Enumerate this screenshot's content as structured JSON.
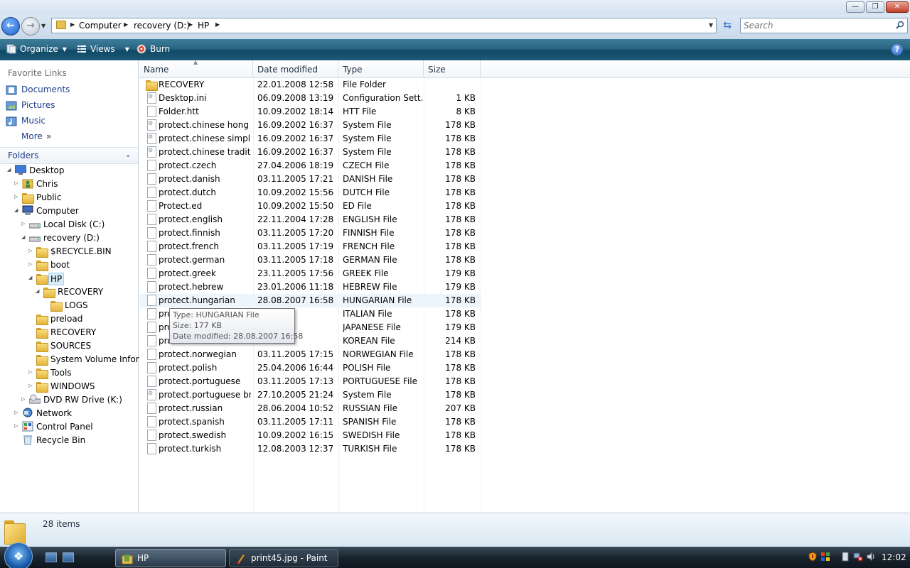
{
  "window": {
    "controls": {
      "minimize": "—",
      "maximize": "❐",
      "close": "✕"
    }
  },
  "address": {
    "crumbs": [
      "Computer",
      "recovery (D:)",
      "HP"
    ]
  },
  "search": {
    "placeholder": "Search"
  },
  "toolbar": {
    "organize": "Organize",
    "views": "Views",
    "burn": "Burn",
    "help": "?"
  },
  "nav": {
    "favorites_title": "Favorite Links",
    "favorites": [
      "Documents",
      "Pictures",
      "Music",
      "More"
    ],
    "folders_label": "Folders",
    "tree": [
      {
        "label": "Desktop",
        "level": 0,
        "exp": "◢",
        "icon": "desktop-icon"
      },
      {
        "label": "Chris",
        "level": 1,
        "exp": "▷",
        "icon": "user-folder-icon"
      },
      {
        "label": "Public",
        "level": 1,
        "exp": "▷",
        "icon": "folder-icon"
      },
      {
        "label": "Computer",
        "level": 1,
        "exp": "◢",
        "icon": "computer-icon"
      },
      {
        "label": "Local Disk (C:)",
        "level": 2,
        "exp": "▷",
        "icon": "drive-icon"
      },
      {
        "label": "recovery (D:)",
        "level": 2,
        "exp": "◢",
        "icon": "drive-icon"
      },
      {
        "label": "$RECYCLE.BIN",
        "level": 3,
        "exp": "▷",
        "icon": "folder-icon"
      },
      {
        "label": "boot",
        "level": 3,
        "exp": "▷",
        "icon": "folder-icon"
      },
      {
        "label": "HP",
        "level": 3,
        "exp": "◢",
        "icon": "folder-icon",
        "selected": true
      },
      {
        "label": "RECOVERY",
        "level": 4,
        "exp": "◢",
        "icon": "folder-icon"
      },
      {
        "label": "LOGS",
        "level": 5,
        "exp": "",
        "icon": "folder-icon"
      },
      {
        "label": "preload",
        "level": 3,
        "exp": "",
        "icon": "folder-icon"
      },
      {
        "label": "RECOVERY",
        "level": 3,
        "exp": "",
        "icon": "folder-icon"
      },
      {
        "label": "SOURCES",
        "level": 3,
        "exp": "",
        "icon": "folder-icon"
      },
      {
        "label": "System Volume Inform",
        "level": 3,
        "exp": "",
        "icon": "folder-icon"
      },
      {
        "label": "Tools",
        "level": 3,
        "exp": "▷",
        "icon": "folder-icon"
      },
      {
        "label": "WINDOWS",
        "level": 3,
        "exp": "▷",
        "icon": "folder-icon"
      },
      {
        "label": "DVD RW Drive (K:)",
        "level": 2,
        "exp": "▷",
        "icon": "dvd-drive-icon"
      },
      {
        "label": "Network",
        "level": 1,
        "exp": "▷",
        "icon": "network-icon"
      },
      {
        "label": "Control Panel",
        "level": 1,
        "exp": "▷",
        "icon": "control-panel-icon"
      },
      {
        "label": "Recycle Bin",
        "level": 1,
        "exp": "",
        "icon": "recycle-bin-icon"
      }
    ]
  },
  "list": {
    "columns": [
      "Name",
      "Date modified",
      "Type",
      "Size"
    ],
    "sort_indicator": "▲",
    "files": [
      {
        "name": "RECOVERY",
        "date": "22.01.2008 12:58",
        "type": "File Folder",
        "size": "",
        "icon": "folder"
      },
      {
        "name": "Desktop.ini",
        "date": "06.09.2008 13:19",
        "type": "Configuration Sett...",
        "size": "1 KB",
        "icon": "sys"
      },
      {
        "name": "Folder.htt",
        "date": "10.09.2002 18:14",
        "type": "HTT File",
        "size": "8 KB",
        "icon": "doc"
      },
      {
        "name": "protect.chinese hong k...",
        "date": "16.09.2002 16:37",
        "type": "System File",
        "size": "178 KB",
        "icon": "sys"
      },
      {
        "name": "protect.chinese simplif...",
        "date": "16.09.2002 16:37",
        "type": "System File",
        "size": "178 KB",
        "icon": "sys"
      },
      {
        "name": "protect.chinese traditi...",
        "date": "16.09.2002 16:37",
        "type": "System File",
        "size": "178 KB",
        "icon": "sys"
      },
      {
        "name": "protect.czech",
        "date": "27.04.2006 18:19",
        "type": "CZECH File",
        "size": "178 KB",
        "icon": "doc"
      },
      {
        "name": "protect.danish",
        "date": "03.11.2005 17:21",
        "type": "DANISH File",
        "size": "178 KB",
        "icon": "doc"
      },
      {
        "name": "protect.dutch",
        "date": "10.09.2002 15:56",
        "type": "DUTCH File",
        "size": "178 KB",
        "icon": "doc"
      },
      {
        "name": "Protect.ed",
        "date": "10.09.2002 15:50",
        "type": "ED File",
        "size": "178 KB",
        "icon": "doc"
      },
      {
        "name": "protect.english",
        "date": "22.11.2004 17:28",
        "type": "ENGLISH File",
        "size": "178 KB",
        "icon": "doc"
      },
      {
        "name": "protect.finnish",
        "date": "03.11.2005 17:20",
        "type": "FINNISH File",
        "size": "178 KB",
        "icon": "doc"
      },
      {
        "name": "protect.french",
        "date": "03.11.2005 17:19",
        "type": "FRENCH File",
        "size": "178 KB",
        "icon": "doc"
      },
      {
        "name": "protect.german",
        "date": "03.11.2005 17:18",
        "type": "GERMAN File",
        "size": "178 KB",
        "icon": "doc"
      },
      {
        "name": "protect.greek",
        "date": "23.11.2005 17:56",
        "type": "GREEK File",
        "size": "179 KB",
        "icon": "doc"
      },
      {
        "name": "protect.hebrew",
        "date": "23.01.2006 11:18",
        "type": "HEBREW File",
        "size": "179 KB",
        "icon": "doc"
      },
      {
        "name": "protect.hungarian",
        "date": "28.08.2007 16:58",
        "type": "HUNGARIAN File",
        "size": "178 KB",
        "icon": "doc",
        "hover": true
      },
      {
        "name": "pro",
        "date": "17:17",
        "type": "ITALIAN File",
        "size": "178 KB",
        "icon": "doc"
      },
      {
        "name": "pro",
        "date": "11:46",
        "type": "JAPANESE File",
        "size": "179 KB",
        "icon": "doc"
      },
      {
        "name": "pro",
        "date": "13:24",
        "type": "KOREAN File",
        "size": "214 KB",
        "icon": "doc"
      },
      {
        "name": "protect.norwegian",
        "date": "03.11.2005 17:15",
        "type": "NORWEGIAN File",
        "size": "178 KB",
        "icon": "doc"
      },
      {
        "name": "protect.polish",
        "date": "25.04.2006 16:44",
        "type": "POLISH File",
        "size": "178 KB",
        "icon": "doc"
      },
      {
        "name": "protect.portuguese",
        "date": "03.11.2005 17:13",
        "type": "PORTUGUESE File",
        "size": "178 KB",
        "icon": "doc"
      },
      {
        "name": "protect.portuguese bra...",
        "date": "27.10.2005 21:24",
        "type": "System File",
        "size": "178 KB",
        "icon": "sys"
      },
      {
        "name": "protect.russian",
        "date": "28.06.2004 10:52",
        "type": "RUSSIAN File",
        "size": "207 KB",
        "icon": "doc"
      },
      {
        "name": "protect.spanish",
        "date": "03.11.2005 17:11",
        "type": "SPANISH File",
        "size": "178 KB",
        "icon": "doc"
      },
      {
        "name": "protect.swedish",
        "date": "10.09.2002 16:15",
        "type": "SWEDISH File",
        "size": "178 KB",
        "icon": "doc"
      },
      {
        "name": "protect.turkish",
        "date": "12.08.2003 12:37",
        "type": "TURKISH File",
        "size": "178 KB",
        "icon": "doc"
      }
    ]
  },
  "tooltip": {
    "type_line": "Type: HUNGARIAN File",
    "size_line": "Size: 177 KB",
    "date_line": "Date modified: 28.08.2007 16:58"
  },
  "details": {
    "item_count": "28 items"
  },
  "taskbar": {
    "start": "❖",
    "tasks": [
      {
        "label": "HP",
        "active": true
      },
      {
        "label": "print45.jpg - Paint",
        "active": false
      }
    ],
    "clock": "12:02"
  }
}
